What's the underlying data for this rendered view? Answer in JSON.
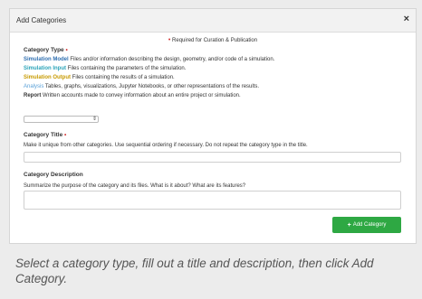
{
  "modal": {
    "title": "Add Categories",
    "close_symbol": "×",
    "required_note": "Required for Curation & Publication",
    "required_marker": "•"
  },
  "category_type": {
    "label": "Category Type",
    "types": [
      {
        "name": "Simulation Model",
        "color": "#2f6fb0",
        "desc": "Files and/or information describing the design, geometry, and/or code of a simulation."
      },
      {
        "name": "Simulation Input",
        "color": "#2aa3b8",
        "desc": "Files containing the parameters of the simulation."
      },
      {
        "name": "Simulation Output",
        "color": "#c79a00",
        "desc": "Files containing the results of a simulation."
      },
      {
        "name": "Analysis",
        "color": "#5aa0d8",
        "desc": "Tables, graphs, visualizations, Jupyter Notebooks, or other representations of the results."
      },
      {
        "name": "Report",
        "color": "#333333",
        "desc": "Written accounts made to convey information about an entire project or simulation."
      }
    ],
    "select_value": "",
    "select_arrow": "⇕"
  },
  "category_title": {
    "label": "Category Title",
    "help": "Make it unique from other categories. Use sequential ordering if necessary. Do not repeat the category type in the title.",
    "value": ""
  },
  "category_description": {
    "label": "Category Description",
    "help": "Summarize the purpose of the category and its files. What is it about? What are its features?",
    "value": ""
  },
  "add_button": {
    "plus": "+",
    "label": "Add Category",
    "color": "#2ea843"
  },
  "caption": "Select a category type, fill out a title and description, then click Add Category."
}
